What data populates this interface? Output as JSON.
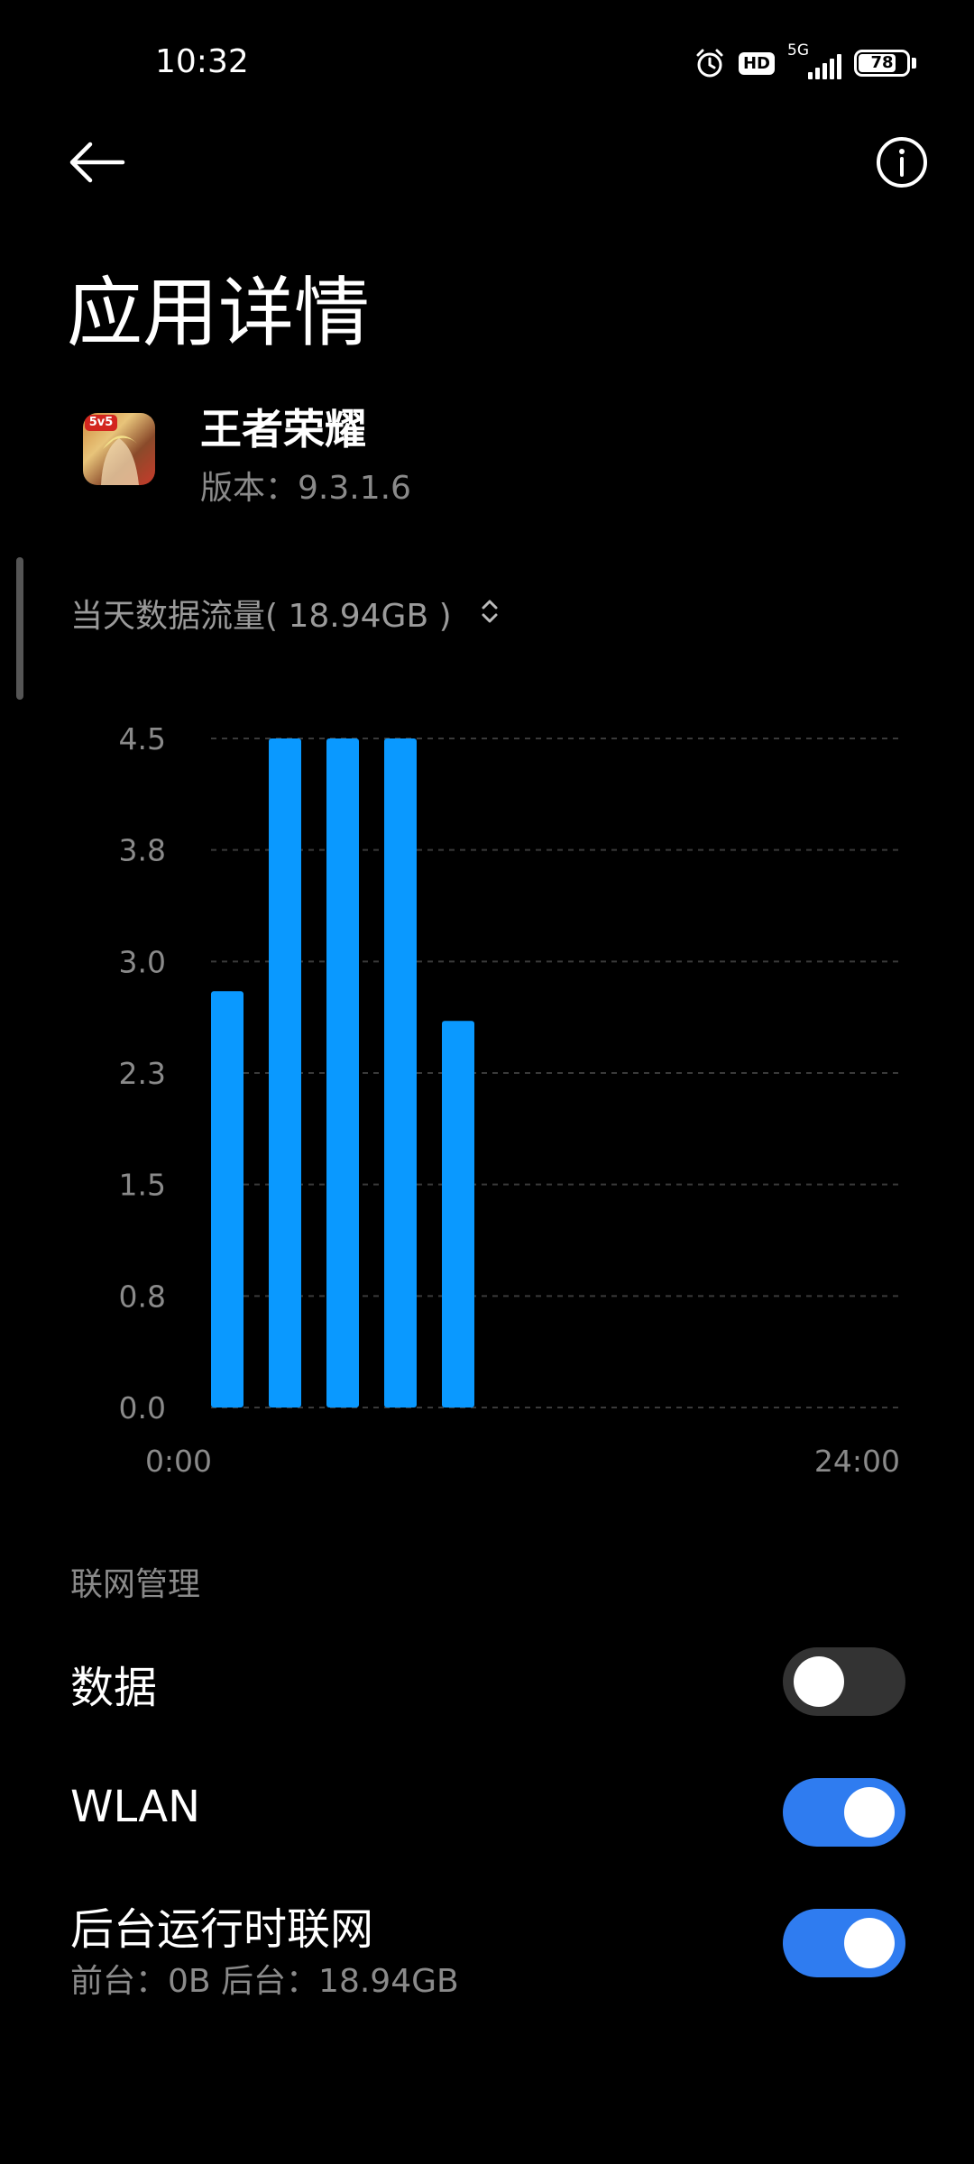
{
  "status": {
    "time": "10:32",
    "net": "5G",
    "hd": "HD",
    "battery": "78"
  },
  "header": {
    "title": "应用详情"
  },
  "app": {
    "name": "王者荣耀",
    "version": "版本：9.3.1.6",
    "icon_badge": "5v5"
  },
  "traffic": {
    "label": "当天数据流量( 18.94GB )"
  },
  "chart_data": {
    "type": "bar",
    "ylim": [
      0,
      4.5
    ],
    "ytick_labels": [
      "4.5",
      "3.8",
      "3.0",
      "2.3",
      "1.5",
      "0.8",
      "0.0"
    ],
    "xtick_labels": [
      "0:00",
      "24:00"
    ],
    "values": [
      2.8,
      4.5,
      4.5,
      4.5,
      2.6
    ],
    "bar_color": "#0a99ff"
  },
  "network": {
    "section_label": "联网管理",
    "rows": [
      {
        "label": "数据",
        "on": false
      },
      {
        "label": "WLAN",
        "on": true
      },
      {
        "label": "后台运行时联网",
        "sub": "前台：0B  后台：18.94GB",
        "on": true
      }
    ]
  },
  "colors": {
    "accent": "#2f7cf0",
    "bar": "#0a99ff"
  }
}
